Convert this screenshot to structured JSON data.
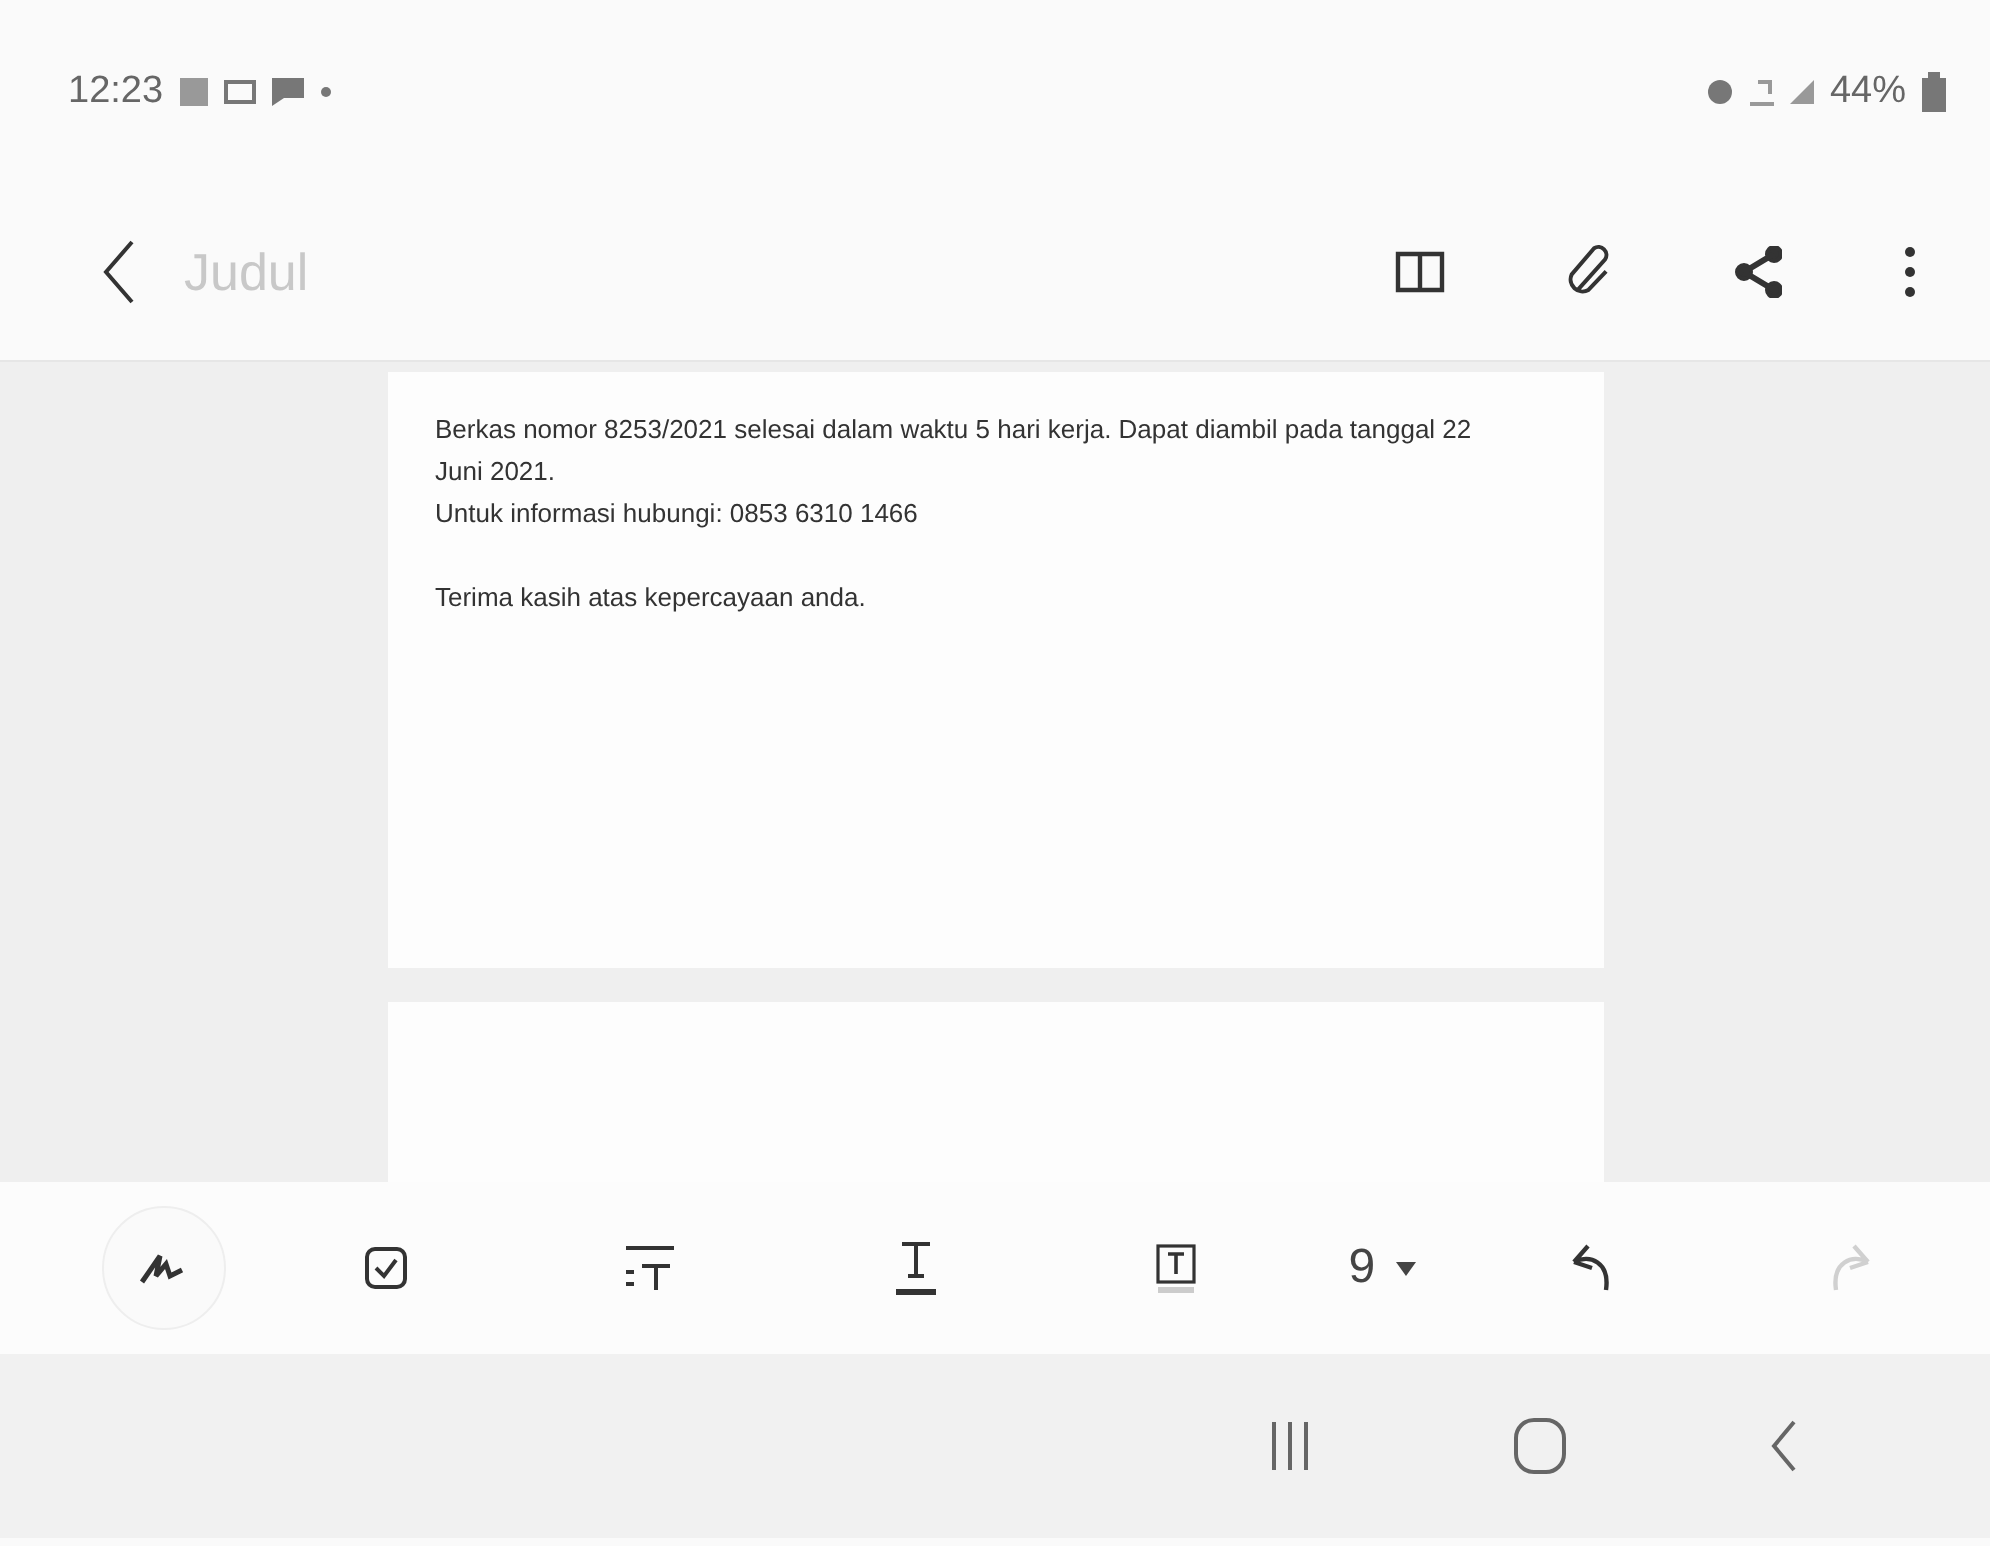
{
  "status_bar": {
    "time": "12:23",
    "battery": "44%"
  },
  "toolbar": {
    "title_placeholder": "Judul"
  },
  "note": {
    "paragraphs": [
      "Berkas nomor 8253/2021 selesai dalam waktu 5 hari kerja. Dapat diambil pada tanggal 22 Juni 2021.",
      "Untuk informasi hubungi: 0853 6310 1466",
      "Terima kasih atas kepercayaan anda."
    ]
  },
  "edit_toolbar": {
    "font_size": "9",
    "redo_disabled": true
  }
}
